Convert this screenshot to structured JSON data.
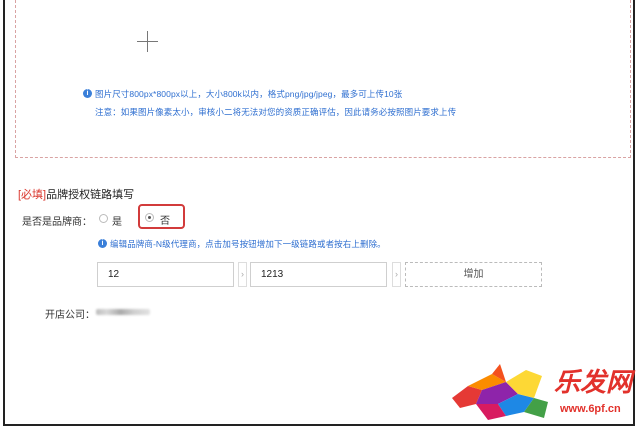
{
  "upload": {
    "add_icon": "plus-icon",
    "tip_line1": "图片尺寸800px*800px以上，大小800k以内，格式png/jpg/jpeg，最多可上传10张",
    "tip_line2": "注意：如果图片像素太小，审核小二将无法对您的资质正确评估，因此请务必按照图片要求上传"
  },
  "brand_chain": {
    "required_tag": "[必填]",
    "title": "品牌授权链路填写",
    "is_brand_owner_label": "是否是品牌商：",
    "options": [
      {
        "label": "是",
        "selected": false
      },
      {
        "label": "否",
        "selected": true
      }
    ],
    "info_text": "编辑品牌商-N级代理商，点击加号按钮增加下一级链路或者按右上删除。",
    "chain_values": [
      "12",
      "1213"
    ],
    "chevron_icon": "chevron-right-icon",
    "add_button_label": "增加"
  },
  "shop_company": {
    "label": "开店公司："
  },
  "watermark": {
    "logo_text": "乐发网",
    "url": "www.6pf.cn",
    "accent_color": "#e2312b"
  },
  "colors": {
    "tip_blue": "#2f6fd0",
    "required_red": "#d9342b",
    "highlight_red": "#d23b3b"
  }
}
